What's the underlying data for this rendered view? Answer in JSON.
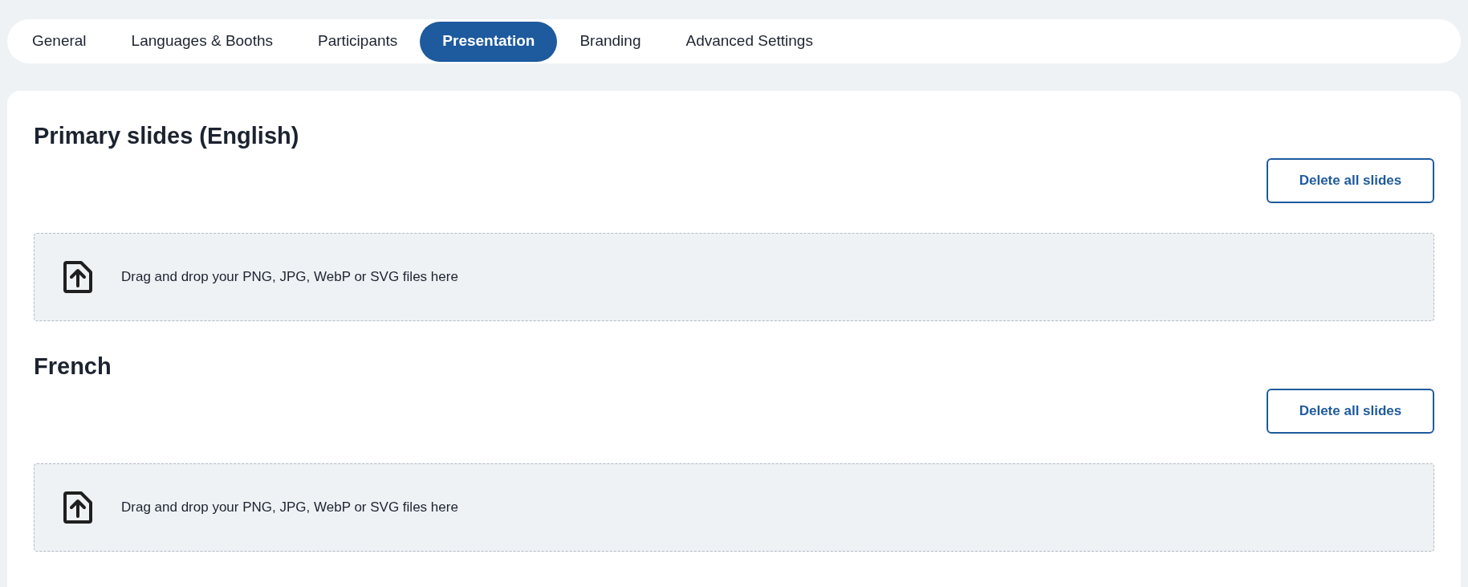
{
  "tabs": [
    {
      "label": "General",
      "selected": false
    },
    {
      "label": "Languages & Booths",
      "selected": false
    },
    {
      "label": "Participants",
      "selected": false
    },
    {
      "label": "Presentation",
      "selected": true
    },
    {
      "label": "Branding",
      "selected": false
    },
    {
      "label": "Advanced Settings",
      "selected": false
    }
  ],
  "sections": [
    {
      "title": "Primary slides (English)",
      "button": "Delete all slides",
      "dropzone": "Drag and drop your PNG, JPG, WebP or SVG files here"
    },
    {
      "title": "French",
      "button": "Delete all slides",
      "dropzone": "Drag and drop your PNG, JPG, WebP or SVG files here"
    }
  ]
}
